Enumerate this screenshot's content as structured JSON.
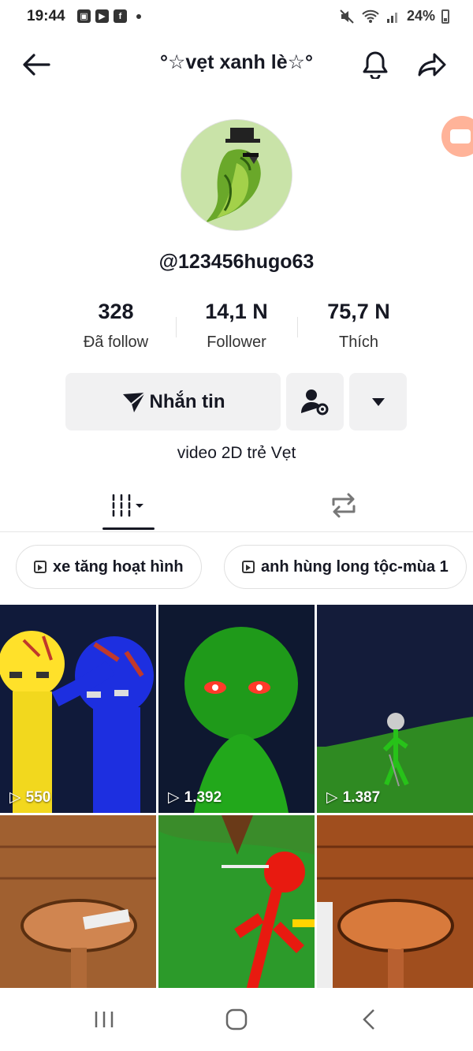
{
  "status": {
    "time": "19:44",
    "battery": "24%"
  },
  "header": {
    "title": "°☆vẹt xanh lè☆°"
  },
  "profile": {
    "handle": "@123456hugo63",
    "bio": "video 2D trẻ Vẹt"
  },
  "stats": [
    {
      "value": "328",
      "label": "Đã follow"
    },
    {
      "value": "14,1 N",
      "label": "Follower"
    },
    {
      "value": "75,7 N",
      "label": "Thích"
    }
  ],
  "actions": {
    "message_label": "Nhắn tin"
  },
  "playlists": [
    "xe tăng hoạt hình",
    "anh hùng long tộc-mùa 1"
  ],
  "videos": [
    {
      "views": "550"
    },
    {
      "views": "1.392"
    },
    {
      "views": "1.387"
    },
    {
      "views": ""
    },
    {
      "views": ""
    },
    {
      "views": ""
    }
  ]
}
